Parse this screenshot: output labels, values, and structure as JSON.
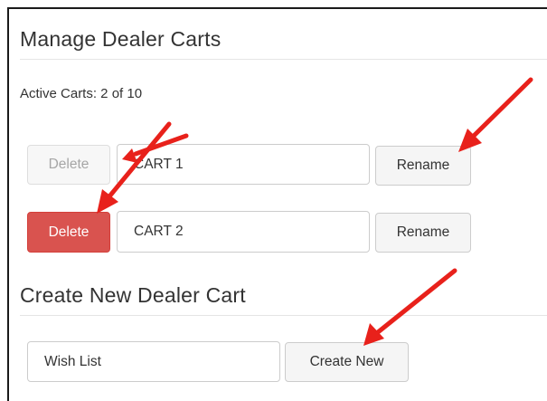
{
  "manage": {
    "title": "Manage Dealer Carts",
    "active_carts": "Active Carts: 2 of 10",
    "carts": [
      {
        "delete_label": "Delete",
        "name": "CART 1",
        "rename_label": "Rename"
      },
      {
        "delete_label": "Delete",
        "name": "CART 2",
        "rename_label": "Rename"
      }
    ]
  },
  "create": {
    "title": "Create New Dealer Cart",
    "input_value": "Wish List",
    "button_label": "Create New"
  },
  "colors": {
    "danger": "#d9534f",
    "annotation_arrow": "#e8211b"
  },
  "annotations": [
    "arrow-icon",
    "arrow-icon",
    "arrow-icon",
    "arrow-icon"
  ]
}
